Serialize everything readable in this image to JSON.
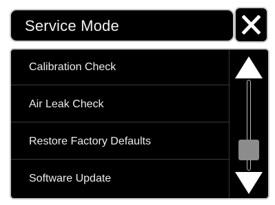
{
  "header": {
    "title": "Service Mode"
  },
  "close_button": {
    "icon": "close-icon",
    "symbol": "✕"
  },
  "menu": {
    "items": [
      {
        "label": "Calibration Check"
      },
      {
        "label": "Air Leak Check"
      },
      {
        "label": "Restore Factory Defaults"
      },
      {
        "label": "Software Update"
      }
    ]
  },
  "scrollbar": {
    "up_icon": "triangle-up-icon",
    "down_icon": "triangle-down-icon",
    "position": 0.85
  },
  "colors": {
    "background": "#000000",
    "text": "#eeeeee",
    "border": "#c8c8c8",
    "thumb": "#8c8c8c"
  }
}
